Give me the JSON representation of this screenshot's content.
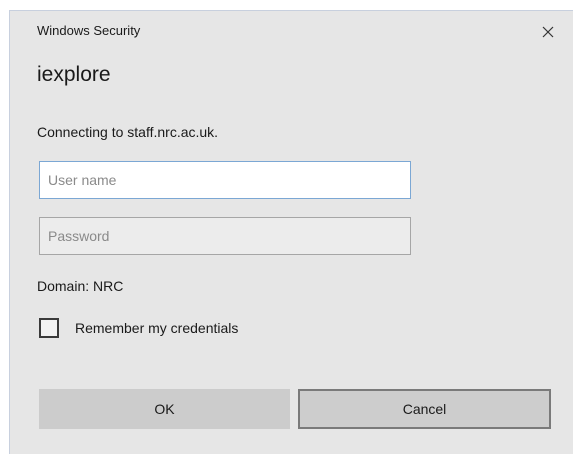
{
  "window": {
    "title": "Windows Security",
    "close_icon": "close-icon"
  },
  "app": {
    "name": "iexplore"
  },
  "message": "Connecting to staff.nrc.ac.uk.",
  "fields": {
    "username": {
      "value": "",
      "placeholder": "User name"
    },
    "password": {
      "value": "",
      "placeholder": "Password"
    }
  },
  "domain": "Domain: NRC",
  "remember": {
    "label": "Remember my credentials",
    "checked": false
  },
  "buttons": {
    "ok": "OK",
    "cancel": "Cancel"
  },
  "colors": {
    "dialog_bg": "#e6e6e6",
    "focus_border": "#7ba7d4"
  }
}
